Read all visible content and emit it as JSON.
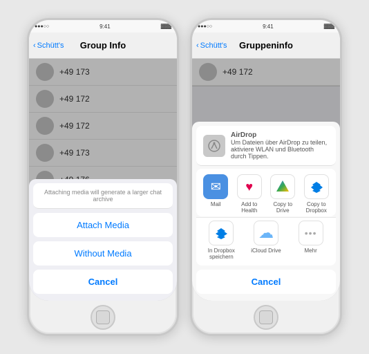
{
  "left_phone": {
    "status_bar": {
      "signal": "●●●●○",
      "time": "9:41",
      "battery": "🔋"
    },
    "nav": {
      "back_label": "Schütt's",
      "title": "Group Info"
    },
    "contacts": [
      {
        "number": "+49 173"
      },
      {
        "number": "+49 172"
      },
      {
        "number": "+49 172"
      },
      {
        "number": "+49 173"
      },
      {
        "number": "+49 176"
      }
    ],
    "modal": {
      "message": "Attaching media will generate a larger chat archive",
      "attach_label": "Attach Media",
      "without_label": "Without Media",
      "cancel_label": "Cancel"
    }
  },
  "right_phone": {
    "status_bar": {
      "signal": "●●●●○",
      "time": "9:41",
      "battery": "🔋"
    },
    "nav": {
      "back_label": "Schütt's",
      "title": "Gruppeninfo"
    },
    "contacts": [
      {
        "number": "+49 172"
      }
    ],
    "share_sheet": {
      "airdrop_title": "AirDrop",
      "airdrop_desc": "Um Dateien über AirDrop zu teilen, aktiviere WLAN und Bluetooth durch Tippen.",
      "apps": [
        {
          "id": "mail",
          "label": "Mail",
          "icon": "✉"
        },
        {
          "id": "health",
          "label": "Add to Health",
          "icon": "♥"
        },
        {
          "id": "drive",
          "label": "Copy to Drive",
          "icon": "▲"
        },
        {
          "id": "dropbox",
          "label": "Copy to Dropbox",
          "icon": "◻"
        }
      ],
      "apps2": [
        {
          "id": "dropbox2",
          "label": "In Dropbox speichern",
          "icon": "◻"
        },
        {
          "id": "icloud",
          "label": "iCloud Drive",
          "icon": "☁"
        },
        {
          "id": "mehr",
          "label": "Mehr",
          "icon": "•••"
        }
      ],
      "cancel_label": "Cancel"
    }
  }
}
